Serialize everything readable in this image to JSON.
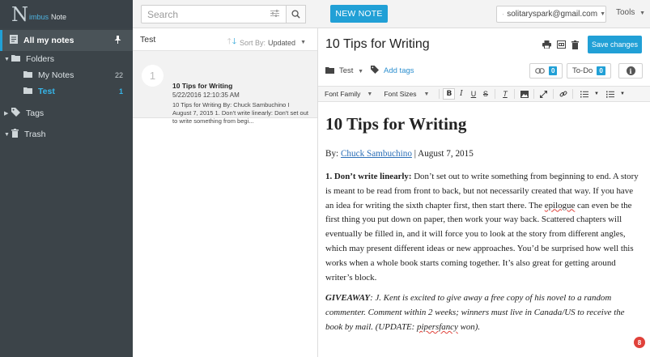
{
  "app": {
    "logo_n": "N",
    "logo_mid": "imbus",
    "logo_note": "Note"
  },
  "topbar": {
    "search_placeholder": "Search",
    "new_note_label": "NEW NOTE",
    "account_email": "solitaryspark@gmail.com",
    "tools_label": "Tools"
  },
  "sidebar": {
    "all_notes_label": "All my notes",
    "folders_label": "Folders",
    "folders": [
      {
        "label": "My Notes",
        "count": "22"
      },
      {
        "label": "Test",
        "count": "1"
      }
    ],
    "tags_label": "Tags",
    "trash_label": "Trash"
  },
  "notelist": {
    "folder_title": "Test",
    "sort_prefix": "Sort By:",
    "sort_value": "Updated",
    "notes": [
      {
        "index": "1",
        "title": "10 Tips for Writing",
        "date": "5/22/2016 12:10:35 AM",
        "snippet": "10 Tips for Writing By: Chuck Sambuchino I August 7, 2015 1. Don't write linearly: Don't set out to write something from begi..."
      }
    ]
  },
  "editor": {
    "title": "10 Tips for Writing",
    "save_label": "Save changes",
    "folder_name": "Test",
    "add_tags_label": "Add tags",
    "attachments_count": "0",
    "todo_label": "To-Do",
    "todo_count": "0",
    "toolbar": {
      "font_family_label": "Font Family",
      "font_sizes_label": "Font Sizes"
    },
    "doc": {
      "heading": "10 Tips for Writing",
      "byline_prefix": "By: ",
      "author": "Chuck Sambuchino",
      "byline_suffix": " | August 7, 2015",
      "p1_lead": "1. Don’t write linearly:",
      "p1_text_a": " Don’t set out to write something from beginning to end. A story is meant to be read from front to back, but not necessarily created that way. If you have an idea for writing the sixth chapter first, then start there. The ",
      "p1_epilogue": "epilogue",
      "p1_text_b": " can even be the first thing you put down on paper, then work your way back. Scattered chapters will eventually be filled in, and it will force you to look at the story from different angles, which may present different ideas or new approaches. You’d be surprised how well this works when a whole book starts coming together. It’s also great for getting around writer’s block.",
      "p2_lead": "GIVEAWAY",
      "p2_text_a": ": J. Kent is excited to give away a free copy of his novel to a random commenter. Comment within 2 weeks; winners must live in Canada/US to receive the book by mail. (UPDATE: ",
      "p2_winner": "pipersfancy",
      "p2_text_b": " won)."
    },
    "notification_count": "8"
  },
  "colors": {
    "accent": "#21a0d6",
    "sidebar_bg": "#3c4449",
    "notification": "#e0413a"
  }
}
